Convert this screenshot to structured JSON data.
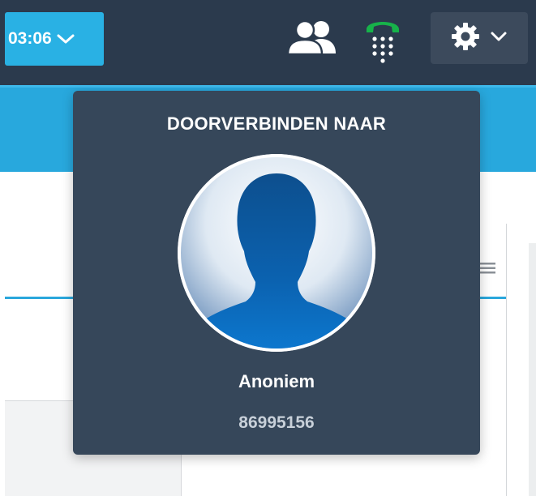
{
  "topbar": {
    "timer_label": "03:06",
    "timer_icon": "chevron-down-icon",
    "contacts_icon": "contacts-icon",
    "phone_icon": "dialpad-phone-icon",
    "settings_icon": "gear-icon",
    "settings_chevron": "chevron-down-icon"
  },
  "popover": {
    "title": "DOORVERBINDEN NAAR",
    "avatar_icon": "anonymous-avatar-icon",
    "contact_name": "Anoniem",
    "contact_number": "86995156"
  },
  "background": {
    "menu_icon": "hamburger-menu-icon"
  },
  "colors": {
    "topbar": "#2b3a4d",
    "accent_blue": "#29b1e4",
    "popover": "#36475a",
    "phone_green": "#17b24a"
  }
}
